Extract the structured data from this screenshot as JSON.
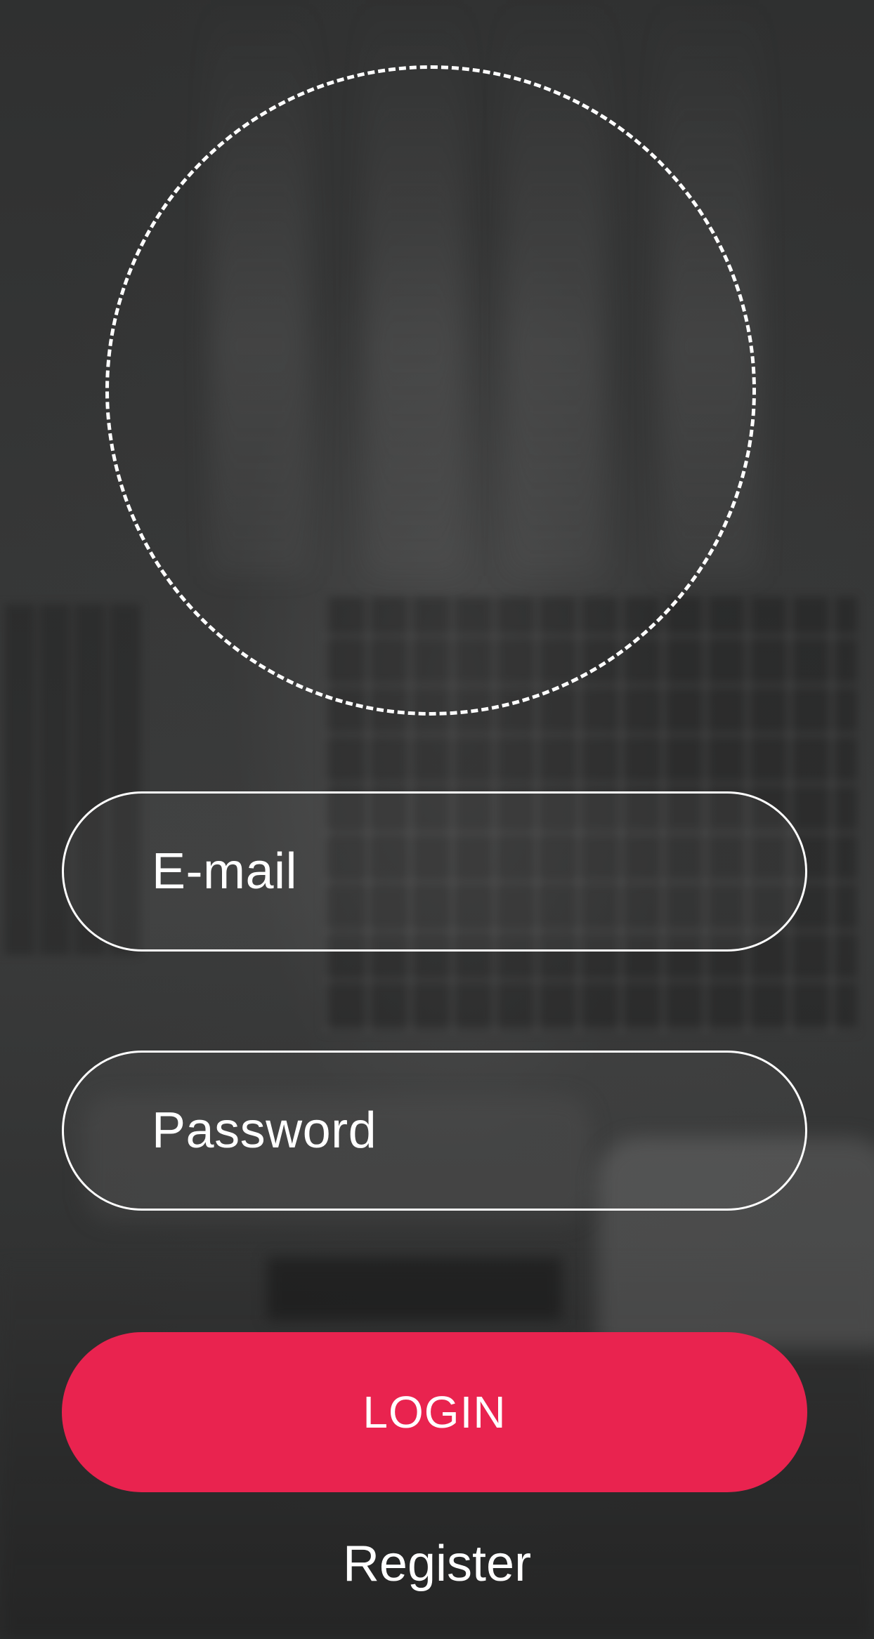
{
  "screen": {
    "background_color": "#2e2f2f",
    "accent_color": "#e9234f"
  },
  "avatar": {
    "icon": "dashed-circle-icon"
  },
  "form": {
    "email": {
      "placeholder": "E-mail"
    },
    "password": {
      "placeholder": "Password"
    },
    "login_label": "LOGIN",
    "register_label": "Register"
  }
}
